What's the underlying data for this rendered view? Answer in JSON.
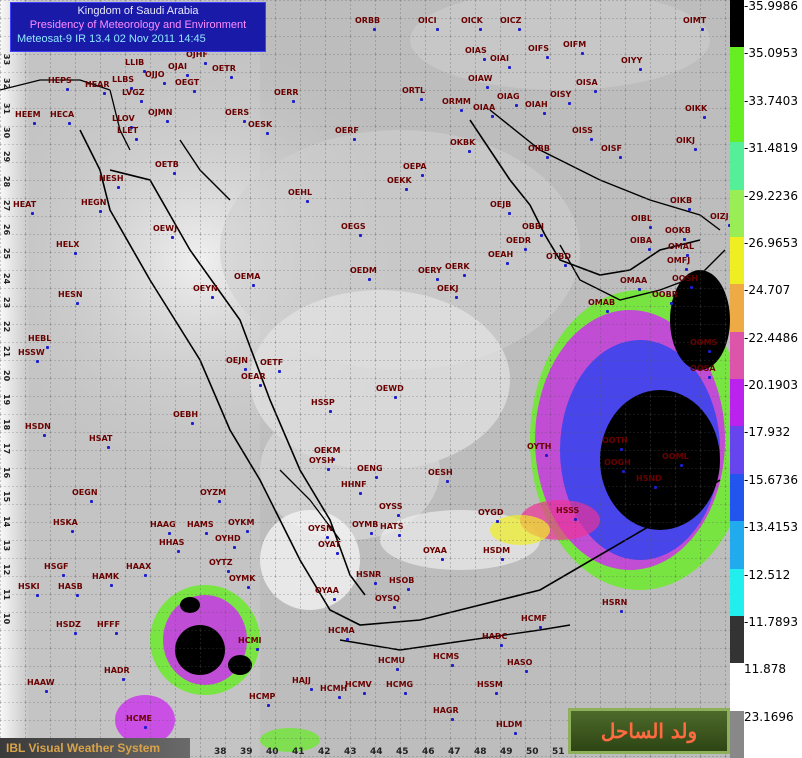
{
  "header": {
    "line1": "Kingdom of Saudi Arabia",
    "line2": "Presidency of Meteorology and Environment",
    "line3": "Meteosat-9 IR 13.4    02 Nov 2011 14:45"
  },
  "footer": {
    "system": "IBL Visual Weather System"
  },
  "watermark": {
    "text": "ولد الساحل"
  },
  "scale": {
    "values": [
      "-35.9986",
      "-35.0953",
      "-33.7403",
      "-31.4819",
      "-29.2236",
      "-26.9653",
      "-24.707",
      "-22.4486",
      "-20.1903",
      "-17.932",
      "-15.6736",
      "-13.4153",
      "-12.512",
      "-11.7893",
      "11.878",
      "23.1696"
    ],
    "colors": [
      "#000000",
      "#66ee22",
      "#66ee22",
      "#55ee99",
      "#99ee55",
      "#eeee22",
      "#eeaa44",
      "#dd55aa",
      "#bb22ee",
      "#6644ee",
      "#2255ee",
      "#22aaee",
      "#22eeee",
      "#333333",
      "#ffffff",
      "#888888"
    ]
  },
  "longitudes": [
    "38",
    "39",
    "40",
    "41",
    "42",
    "43",
    "44",
    "45",
    "46",
    "47",
    "48",
    "49",
    "50",
    "51"
  ],
  "latitudes": [
    "33",
    "32",
    "31",
    "30",
    "29",
    "28",
    "27",
    "26",
    "25",
    "24",
    "23",
    "22",
    "21",
    "20",
    "19",
    "18",
    "17",
    "16",
    "15",
    "14",
    "13",
    "12",
    "11",
    "10"
  ],
  "stations": [
    {
      "name": "ORBB"
    },
    {
      "name": "OICI"
    },
    {
      "name": "OICK"
    },
    {
      "name": "OICZ"
    },
    {
      "name": "OIMT"
    },
    {
      "name": "OIFS"
    },
    {
      "name": "OIFM"
    },
    {
      "name": "OIAS"
    },
    {
      "name": "OIAI"
    },
    {
      "name": "OIYY"
    },
    {
      "name": "OJHF"
    },
    {
      "name": "LLIB"
    },
    {
      "name": "OJAI"
    },
    {
      "name": "OJJO"
    },
    {
      "name": "OJHF"
    },
    {
      "name": "OETR"
    },
    {
      "name": "OEGT"
    },
    {
      "name": "HEAR"
    },
    {
      "name": "LLBS"
    },
    {
      "name": "LVGZ"
    },
    {
      "name": "HEPS"
    },
    {
      "name": "OIAW"
    },
    {
      "name": "OISA"
    },
    {
      "name": "ORTL"
    },
    {
      "name": "OIAG"
    },
    {
      "name": "OISY"
    },
    {
      "name": "OERR"
    },
    {
      "name": "ORMM"
    },
    {
      "name": "OIAA"
    },
    {
      "name": "OIAH"
    },
    {
      "name": "OIKK"
    },
    {
      "name": "HEEM"
    },
    {
      "name": "HECA"
    },
    {
      "name": "OJMN"
    },
    {
      "name": "LLOV"
    },
    {
      "name": "LLET"
    },
    {
      "name": "OERS"
    },
    {
      "name": "OESK"
    },
    {
      "name": "OERF"
    },
    {
      "name": "OISS"
    },
    {
      "name": "OKBK"
    },
    {
      "name": "OIBB"
    },
    {
      "name": "OISF"
    },
    {
      "name": "OIKJ"
    },
    {
      "name": "OETB"
    },
    {
      "name": "HESH"
    },
    {
      "name": "OEPA"
    },
    {
      "name": "OEKK"
    },
    {
      "name": "OEHL"
    },
    {
      "name": "HEGN"
    },
    {
      "name": "HEAT"
    },
    {
      "name": "OEJB"
    },
    {
      "name": "OIKB"
    },
    {
      "name": "OIBL"
    },
    {
      "name": "OIZJ"
    },
    {
      "name": "OOKB"
    },
    {
      "name": "OEWJ"
    },
    {
      "name": "OEGS"
    },
    {
      "name": "OBBI"
    },
    {
      "name": "OIBA"
    },
    {
      "name": "OEDR"
    },
    {
      "name": "OMAL"
    },
    {
      "name": "HELX"
    },
    {
      "name": "OEAH"
    },
    {
      "name": "OTBD"
    },
    {
      "name": "OMFJ"
    },
    {
      "name": "OERK"
    },
    {
      "name": "OEDM"
    },
    {
      "name": "OERY"
    },
    {
      "name": "OEMA"
    },
    {
      "name": "OMAA"
    },
    {
      "name": "OOSH"
    },
    {
      "name": "OEKJ"
    },
    {
      "name": "HESN"
    },
    {
      "name": "OEYN"
    },
    {
      "name": "OOBR"
    },
    {
      "name": "OMAB"
    },
    {
      "name": "HEBL"
    },
    {
      "name": "HSSW"
    },
    {
      "name": "OEJN"
    },
    {
      "name": "OETF"
    },
    {
      "name": "OEAR"
    },
    {
      "name": "OOMS"
    },
    {
      "name": "OOSA"
    },
    {
      "name": "OEWD"
    },
    {
      "name": "HSSP"
    },
    {
      "name": "OEBH"
    },
    {
      "name": "HSDN"
    },
    {
      "name": "OEKM"
    },
    {
      "name": "OOML"
    },
    {
      "name": "HSAT"
    },
    {
      "name": "OENG"
    },
    {
      "name": "OESH"
    },
    {
      "name": "OYTH"
    },
    {
      "name": "OOTH"
    },
    {
      "name": "OOGH"
    },
    {
      "name": "HSND"
    },
    {
      "name": "OEGN"
    },
    {
      "name": "OYSH"
    },
    {
      "name": "HHNF"
    },
    {
      "name": "OYZM"
    },
    {
      "name": "OYSS"
    },
    {
      "name": "OYGD"
    },
    {
      "name": "HSSS"
    },
    {
      "name": "HSKA"
    },
    {
      "name": "HAAG"
    },
    {
      "name": "HAMS"
    },
    {
      "name": "OYKM"
    },
    {
      "name": "OYSN"
    },
    {
      "name": "OYMB"
    },
    {
      "name": "HATS"
    },
    {
      "name": "HHAS"
    },
    {
      "name": "OYHD"
    },
    {
      "name": "OYAT"
    },
    {
      "name": "OYAA"
    },
    {
      "name": "HSDM"
    },
    {
      "name": "HSGF"
    },
    {
      "name": "HAAX"
    },
    {
      "name": "OYTZ"
    },
    {
      "name": "HSNR"
    },
    {
      "name": "HAMK"
    },
    {
      "name": "OYMK"
    },
    {
      "name": "HSOB"
    },
    {
      "name": "HSKI"
    },
    {
      "name": "HASB"
    },
    {
      "name": "OYAA"
    },
    {
      "name": "OYSQ"
    },
    {
      "name": "HSRN"
    },
    {
      "name": "HSDZ"
    },
    {
      "name": "HFFF"
    },
    {
      "name": "HCMA"
    },
    {
      "name": "HCMF"
    },
    {
      "name": "HADC"
    },
    {
      "name": "HCMI"
    },
    {
      "name": "HCMU"
    },
    {
      "name": "HCMS"
    },
    {
      "name": "HASO"
    },
    {
      "name": "HADR"
    },
    {
      "name": "HAJJ"
    },
    {
      "name": "HCMH"
    },
    {
      "name": "HCMV"
    },
    {
      "name": "HCMG"
    },
    {
      "name": "HSSM"
    },
    {
      "name": "HAAW"
    },
    {
      "name": "HCMP"
    },
    {
      "name": "HAGR"
    },
    {
      "name": "HCME"
    },
    {
      "name": "HLDM"
    }
  ]
}
